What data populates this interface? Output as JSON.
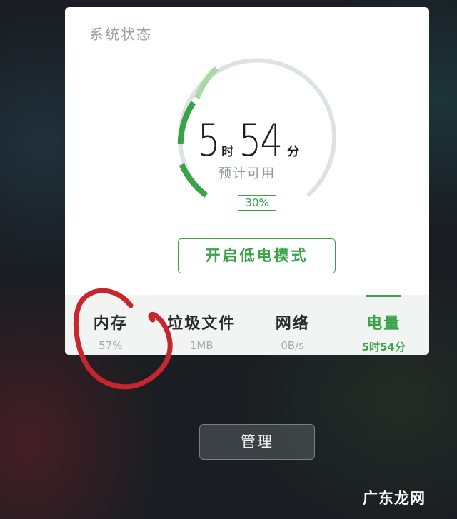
{
  "card": {
    "title": "系统状态"
  },
  "battery": {
    "hours": "5",
    "hour_unit": "时",
    "minutes": "54",
    "minute_unit": "分",
    "label": "预计可用",
    "percent_text": "30%",
    "level_fraction": 0.3
  },
  "low_power_button": "开启低电模式",
  "tabs": [
    {
      "name": "内存",
      "value": "57%"
    },
    {
      "name": "垃圾文件",
      "value": "1MB"
    },
    {
      "name": "网络",
      "value": "0B/s"
    },
    {
      "name": "电量",
      "value": "5时54分"
    }
  ],
  "manage_button": "管理",
  "watermark": "广东龙网",
  "colors": {
    "accent": "#3aa34a",
    "track": "#dfe2e3",
    "light_green": "#a9d9a4",
    "annotation": "#c8262f"
  }
}
